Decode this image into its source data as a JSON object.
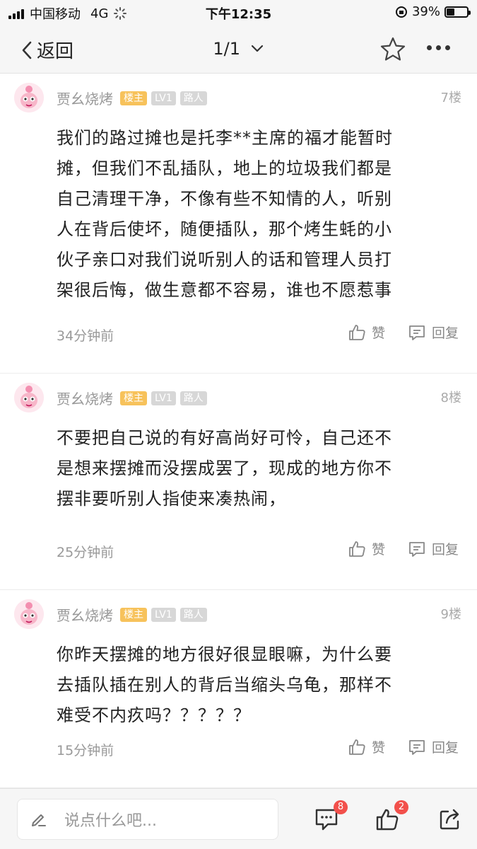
{
  "status_bar": {
    "carrier": "中国移动",
    "network": "4G",
    "time": "下午12:35",
    "battery_text": "39%",
    "battery_level": 0.39
  },
  "nav": {
    "back_label": "返回",
    "page_indicator": "1/1"
  },
  "posts": [
    {
      "username": "贾幺烧烤",
      "badge_host": "楼主",
      "badge_level": "LV1",
      "badge_role": "路人",
      "floor": "7楼",
      "lines": [
        "我们的路过摊也是托李**主席的福才能暂时",
        "摊，但我们不乱插队，地上的垃圾我们都是",
        "自己清理干净，不像有些不知情的人，听别",
        "人在背后使坏，随便插队，那个烤生蚝的小",
        "伙子亲口对我们说听别人的话和管理人员打",
        "架很后悔，做生意都不容易，谁也不愿惹事"
      ],
      "time": "34分钟前",
      "like_label": "赞",
      "reply_label": "回复"
    },
    {
      "username": "贾幺烧烤",
      "badge_host": "楼主",
      "badge_level": "LV1",
      "badge_role": "路人",
      "floor": "8楼",
      "lines": [
        "不要把自己说的有好高尚好可怜，自己还不",
        "是想来摆摊而没摆成罢了，现成的地方你不",
        "摆非要听别人指使来凑热闹，"
      ],
      "time": "25分钟前",
      "like_label": "赞",
      "reply_label": "回复"
    },
    {
      "username": "贾幺烧烤",
      "badge_host": "楼主",
      "badge_level": "LV1",
      "badge_role": "路人",
      "floor": "9楼",
      "lines": [
        "你昨天摆摊的地方很好很显眼嘛，为什么要",
        "去插队插在别人的背后当缩头乌龟，那样不",
        "难受不内疚吗？？？？？"
      ],
      "time": "15分钟前",
      "like_label": "赞",
      "reply_label": "回复"
    }
  ],
  "bottom_bar": {
    "input_placeholder": "说点什么吧...",
    "comment_count": "8",
    "like_count": "2"
  }
}
